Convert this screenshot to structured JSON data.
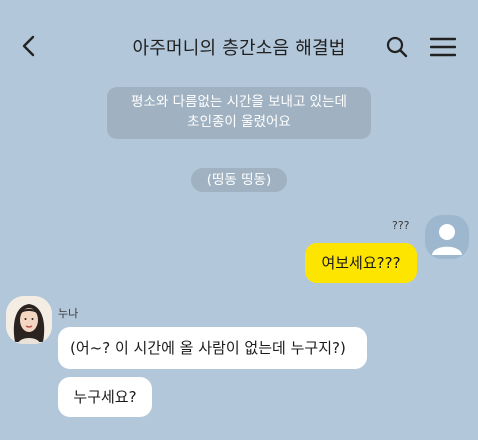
{
  "header": {
    "title": "아주머니의 층간소음 해결법",
    "back_icon": "chevron-left-icon",
    "search_icon": "search-icon",
    "menu_icon": "hamburger-menu-icon"
  },
  "system": {
    "notice_line1": "평소와 다름없는 시간을 보내고 있는데",
    "notice_line2": "초인종이 울렸어요",
    "ring_text": "(띵동 띵동)"
  },
  "me": {
    "name": "???",
    "avatar_icon": "default-profile-icon",
    "message": "여보세요???"
  },
  "them": {
    "name": "누나",
    "avatar_icon": "woman-portrait-icon",
    "message1": "(어~? 이 시간에 올 사람이 없는데 누구지?)",
    "message2": "누구세요?"
  },
  "colors": {
    "background": "#b2c7d9",
    "my_bubble": "#fee500",
    "their_bubble": "#ffffff",
    "system_bubble": "#a0b2c2"
  }
}
